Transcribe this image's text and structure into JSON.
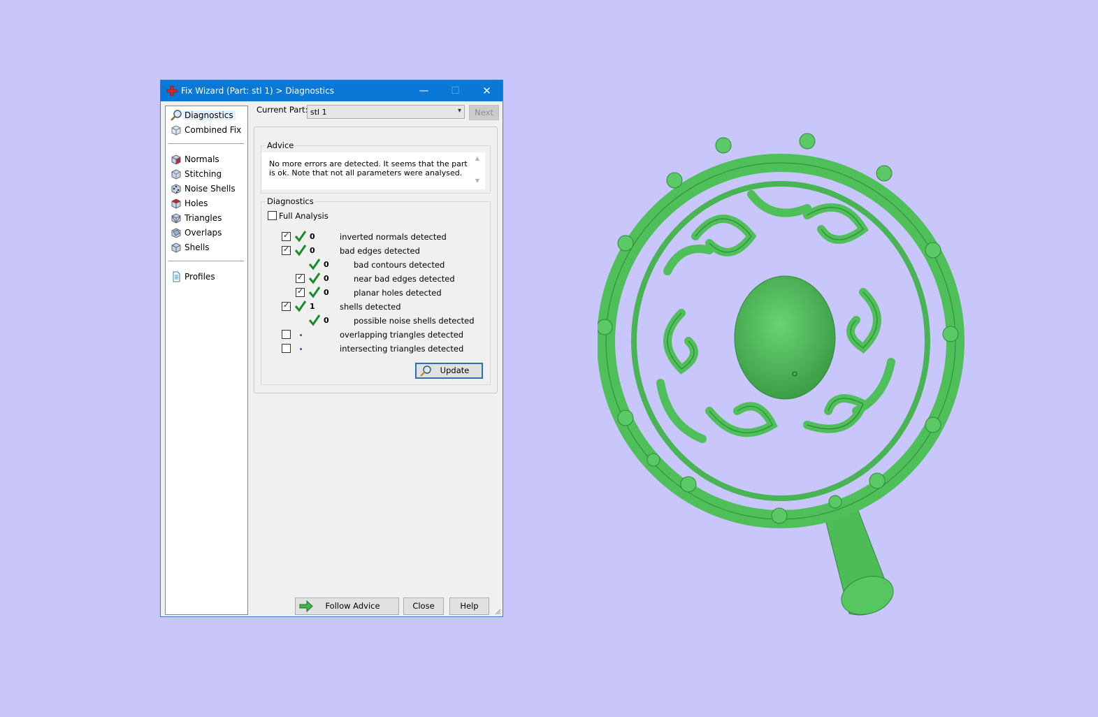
{
  "window": {
    "title": "Fix Wizard (Part: stl 1) > Diagnostics",
    "minimize": "—",
    "maximize": "☐",
    "close": "✕"
  },
  "sidebar": {
    "items": [
      {
        "label": "Diagnostics",
        "icon": "magnifier-icon"
      },
      {
        "label": "Combined Fix",
        "icon": "cube-icon"
      },
      {
        "label": "Normals",
        "icon": "normals-cube-icon"
      },
      {
        "label": "Stitching",
        "icon": "stitching-cube-icon"
      },
      {
        "label": "Noise Shells",
        "icon": "noise-shells-cube-icon"
      },
      {
        "label": "Holes",
        "icon": "holes-cube-icon"
      },
      {
        "label": "Triangles",
        "icon": "triangles-cube-icon"
      },
      {
        "label": "Overlaps",
        "icon": "overlaps-cube-icon"
      },
      {
        "label": "Shells",
        "icon": "shells-cube-icon"
      },
      {
        "label": "Profiles",
        "icon": "document-icon"
      }
    ]
  },
  "current_part": {
    "label": "Current Part:",
    "value": "stl 1",
    "next_label": "Next"
  },
  "advice": {
    "title": "Advice",
    "text": "No more errors are detected. It seems that the part is ok. Note that not all parameters were analysed."
  },
  "diagnostics": {
    "title": "Diagnostics",
    "full_analysis_label": "Full Analysis",
    "full_analysis_checked": false,
    "rows": [
      {
        "checkbox": true,
        "checked": true,
        "status": "ok",
        "count": "0",
        "label": "inverted normals detected",
        "indent": 0
      },
      {
        "checkbox": true,
        "checked": true,
        "status": "ok",
        "count": "0",
        "label": "bad edges detected",
        "indent": 0
      },
      {
        "checkbox": false,
        "checked": false,
        "status": "ok",
        "count": "0",
        "label": "bad contours detected",
        "indent": 1
      },
      {
        "checkbox": true,
        "checked": true,
        "status": "ok",
        "count": "0",
        "label": "near bad edges detected",
        "indent": 1
      },
      {
        "checkbox": true,
        "checked": true,
        "status": "ok",
        "count": "0",
        "label": "planar holes detected",
        "indent": 1
      },
      {
        "checkbox": true,
        "checked": true,
        "status": "ok",
        "count": "1",
        "label": "shells detected",
        "indent": 0
      },
      {
        "checkbox": false,
        "checked": false,
        "status": "ok",
        "count": "0",
        "label": "possible noise shells detected",
        "indent": 1
      },
      {
        "checkbox": true,
        "checked": false,
        "status": "none",
        "count": "",
        "label": "overlapping triangles detected",
        "indent": 0
      },
      {
        "checkbox": true,
        "checked": false,
        "status": "none",
        "count": "",
        "label": "intersecting triangles detected",
        "indent": 0
      }
    ],
    "update_label": "Update"
  },
  "footer": {
    "follow_advice_label": "Follow Advice",
    "close_label": "Close",
    "help_label": "Help"
  },
  "colors": {
    "background": "#c8c6fb",
    "titlebar": "#0a78d7",
    "model_green": "#4fbf5a",
    "check_green": "#1a8a2a"
  }
}
